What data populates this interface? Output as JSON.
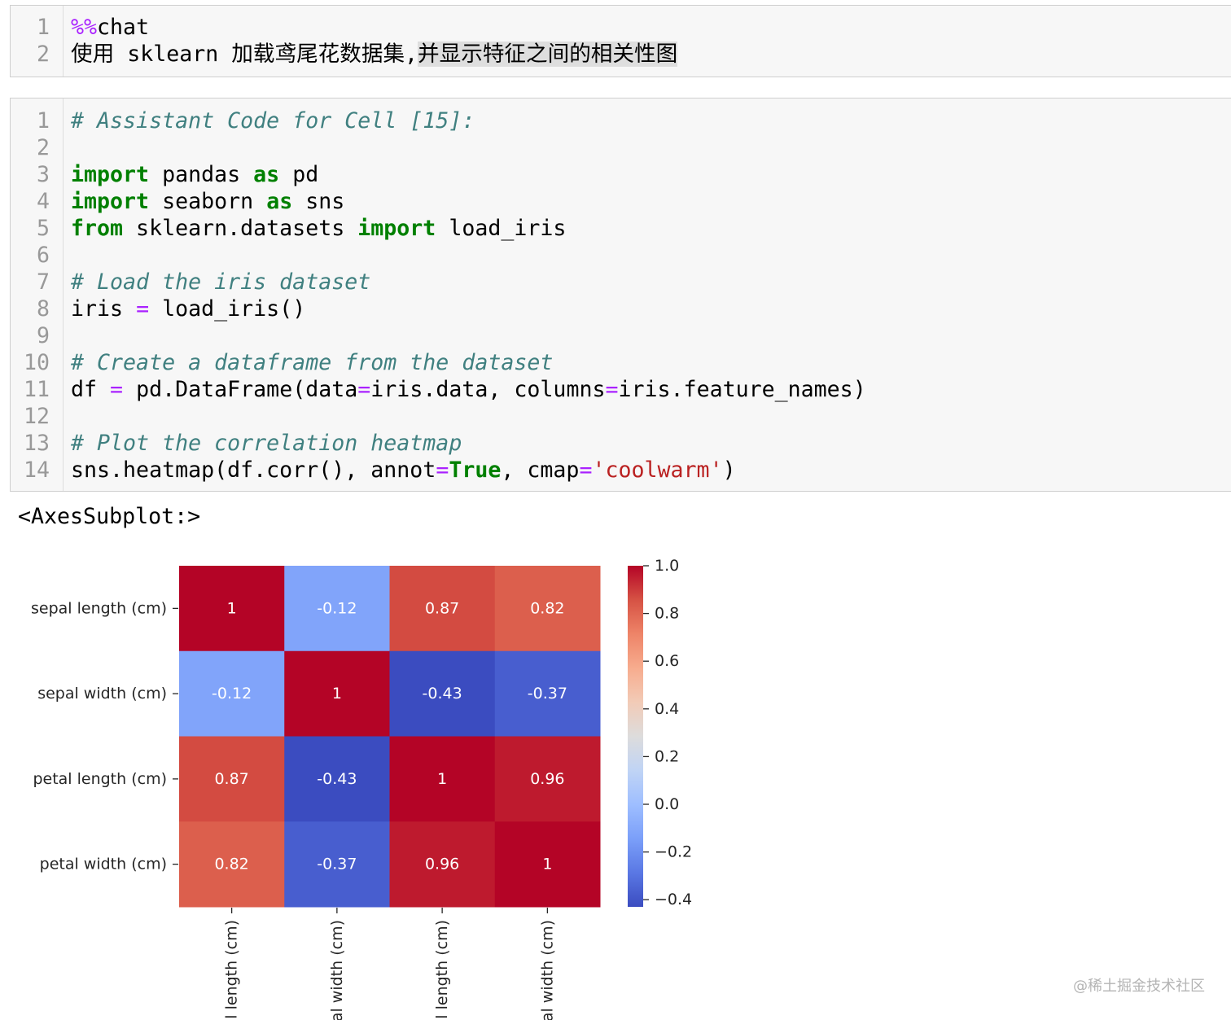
{
  "theme": {
    "cell_background": "#f7f7f7",
    "cell_border": "#cfcfcf",
    "gutter_border": "#dddddd",
    "line_number": "#999999",
    "text": "#000000",
    "axis_text": "#262626"
  },
  "notebook": {
    "cells": [
      {
        "lines": [
          {
            "n": "1",
            "tokens": [
              {
                "t": "%%",
                "c": "#aa22ff"
              },
              {
                "t": "chat"
              }
            ]
          },
          {
            "n": "2",
            "tokens": [
              {
                "t": "使用 sklearn 加载鸢尾花数据集,"
              },
              {
                "t": "并显示特征之间的相关性图",
                "bg": "#dedede"
              }
            ]
          }
        ]
      },
      {
        "lines": [
          {
            "n": "1",
            "tokens": [
              {
                "t": "# Assistant Code for Cell [15]:",
                "c": "#408080",
                "i": true
              }
            ]
          },
          {
            "n": "2",
            "tokens": []
          },
          {
            "n": "3",
            "tokens": [
              {
                "t": "import",
                "c": "#008000",
                "b": true
              },
              {
                "t": " pandas "
              },
              {
                "t": "as",
                "c": "#008000",
                "b": true
              },
              {
                "t": " pd"
              }
            ]
          },
          {
            "n": "4",
            "tokens": [
              {
                "t": "import",
                "c": "#008000",
                "b": true
              },
              {
                "t": " seaborn "
              },
              {
                "t": "as",
                "c": "#008000",
                "b": true
              },
              {
                "t": " sns"
              }
            ]
          },
          {
            "n": "5",
            "tokens": [
              {
                "t": "from",
                "c": "#008000",
                "b": true
              },
              {
                "t": " sklearn.datasets "
              },
              {
                "t": "import",
                "c": "#008000",
                "b": true
              },
              {
                "t": " load_iris"
              }
            ]
          },
          {
            "n": "6",
            "tokens": []
          },
          {
            "n": "7",
            "tokens": [
              {
                "t": "# Load the iris dataset",
                "c": "#408080",
                "i": true
              }
            ]
          },
          {
            "n": "8",
            "tokens": [
              {
                "t": "iris "
              },
              {
                "t": "=",
                "c": "#aa22ff"
              },
              {
                "t": " load_iris()"
              }
            ]
          },
          {
            "n": "9",
            "tokens": []
          },
          {
            "n": "10",
            "tokens": [
              {
                "t": "# Create a dataframe from the dataset",
                "c": "#408080",
                "i": true
              }
            ]
          },
          {
            "n": "11",
            "tokens": [
              {
                "t": "df "
              },
              {
                "t": "=",
                "c": "#aa22ff"
              },
              {
                "t": " pd.DataFrame(data"
              },
              {
                "t": "=",
                "c": "#aa22ff"
              },
              {
                "t": "iris.data, columns"
              },
              {
                "t": "=",
                "c": "#aa22ff"
              },
              {
                "t": "iris.feature_names)"
              }
            ]
          },
          {
            "n": "12",
            "tokens": []
          },
          {
            "n": "13",
            "tokens": [
              {
                "t": "# Plot the correlation heatmap",
                "c": "#408080",
                "i": true
              }
            ]
          },
          {
            "n": "14",
            "tokens": [
              {
                "t": "sns.heatmap(df.corr(), annot"
              },
              {
                "t": "=",
                "c": "#aa22ff"
              },
              {
                "t": "True",
                "c": "#008000",
                "b": true
              },
              {
                "t": ", cmap"
              },
              {
                "t": "=",
                "c": "#aa22ff"
              },
              {
                "t": "'coolwarm'",
                "c": "#ba2121"
              },
              {
                "t": ")"
              }
            ]
          }
        ]
      }
    ],
    "output": {
      "text": "<AxesSubplot:>"
    }
  },
  "chart_data": {
    "type": "heatmap",
    "rows": [
      "sepal length (cm)",
      "sepal width (cm)",
      "petal length (cm)",
      "petal width (cm)"
    ],
    "columns": [
      "sepal length (cm)",
      "sepal width (cm)",
      "petal length (cm)",
      "petal width (cm)"
    ],
    "values": [
      [
        1,
        -0.12,
        0.87,
        0.82
      ],
      [
        -0.12,
        1,
        -0.43,
        -0.37
      ],
      [
        0.87,
        -0.43,
        1,
        0.96
      ],
      [
        0.82,
        -0.37,
        0.96,
        1
      ]
    ],
    "annot_labels": [
      [
        "1",
        "-0.12",
        "0.87",
        "0.82"
      ],
      [
        "-0.12",
        "1",
        "-0.43",
        "-0.37"
      ],
      [
        "0.87",
        "-0.43",
        "1",
        "0.96"
      ],
      [
        "0.82",
        "-0.37",
        "0.96",
        "1"
      ]
    ],
    "annot_color": "#ffffff",
    "vmin": -0.43,
    "vmax": 1.0,
    "grid": false,
    "colorbar": {
      "position": "right",
      "ticks": [
        1.0,
        0.8,
        0.6,
        0.4,
        0.2,
        0.0,
        -0.2,
        -0.4
      ],
      "tick_labels": [
        "1.0",
        "0.8",
        "0.6",
        "0.4",
        "0.2",
        "0.0",
        "−0.2",
        "−0.4"
      ]
    },
    "colormap_stops": [
      "#3b4cc0",
      "#5a78e4",
      "#7b9ff9",
      "#9ebeff",
      "#c0d4f5",
      "#dddcdc",
      "#f2cbb7",
      "#f7ac8e",
      "#ee8468",
      "#d65244",
      "#b40426"
    ]
  },
  "watermark": "@稀土掘金技术社区"
}
